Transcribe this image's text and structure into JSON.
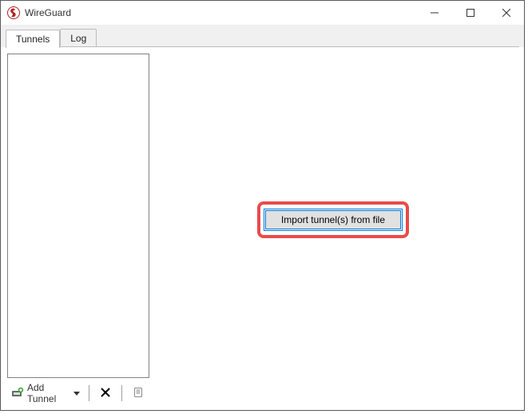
{
  "window": {
    "title": "WireGuard"
  },
  "tabs": {
    "tunnels": "Tunnels",
    "log": "Log"
  },
  "toolbar": {
    "add_tunnel_label": "Add Tunnel"
  },
  "main": {
    "import_button_label": "Import tunnel(s) from file"
  }
}
